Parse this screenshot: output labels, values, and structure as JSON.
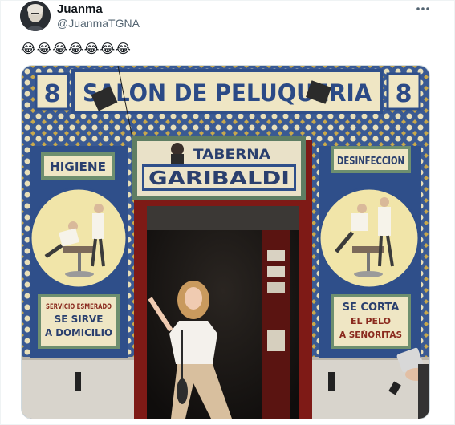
{
  "tweet": {
    "author_name": "Juanma",
    "author_handle": "@JuanmaTGNA",
    "text": "😂😂😂😂😂😂😂",
    "more_icon": "more-horizontal-icon"
  },
  "photo": {
    "top_sign": "SALON DE PELUQUERIA",
    "left_number": "8",
    "right_number": "8",
    "center_sign_line1": "TABERNA",
    "center_sign_line2": "GARIBALDI",
    "left_panel_title": "HIGIENE",
    "right_panel_title": "DESINFECCION",
    "left_panel_bottom": [
      "SERVICIO ESMERADO",
      "SE SIRVE",
      "A DOMICILIO"
    ],
    "right_panel_bottom": [
      "SE CORTA",
      "EL PELO",
      "A SEÑORITAS"
    ]
  },
  "colors": {
    "tile_blue": "#2f4f8a",
    "tile_cream": "#efe6c4",
    "door_red": "#8a1f1a",
    "sign_green": "#5e7d63"
  }
}
